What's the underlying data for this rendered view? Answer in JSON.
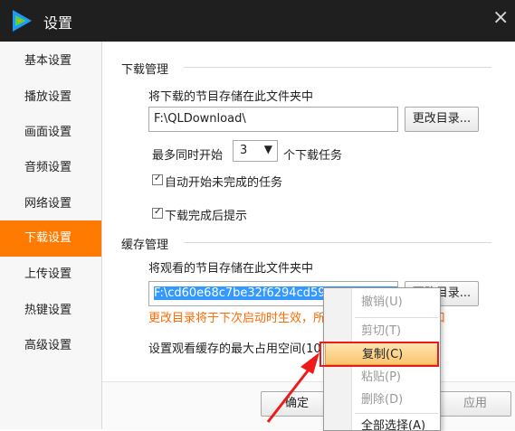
{
  "window": {
    "title": "设置",
    "close_symbol": "×",
    "logo_icon": "tencent-video-logo-icon",
    "brand_colors": [
      "#1a9bfc",
      "#59d241",
      "#ff9a18"
    ]
  },
  "sidebar": {
    "items": [
      {
        "label": "基本设置"
      },
      {
        "label": "播放设置"
      },
      {
        "label": "画面设置"
      },
      {
        "label": "音频设置"
      },
      {
        "label": "网络设置"
      },
      {
        "label": "下载设置"
      },
      {
        "label": "上传设置"
      },
      {
        "label": "热键设置"
      },
      {
        "label": "高级设置"
      }
    ],
    "active_label": "下载设置",
    "active_color": "#ff7a00"
  },
  "download": {
    "section_title": "下载管理",
    "save_label": "将下载的节目存储在此文件夹中",
    "path_value": "F:\\QLDownload\\",
    "change_dir_button": "更改目录...",
    "max_prefix": "最多同时开始",
    "max_value": "3",
    "max_suffix": "个下载任务",
    "auto_start_label": "自动开始未完成的任务",
    "auto_start_checked": true,
    "notify_label": "下载完成后提示",
    "notify_checked": true
  },
  "cache": {
    "section_title": "缓存管理",
    "save_label": "将观看的节目存储在此文件夹中",
    "path_value": "F:\\cd60e68c7be32f6294cd59c2174b2208",
    "change_dir_button": "更改目录...",
    "warning_text": "更改目录将于下次启动时生效，所",
    "warning_suffix": "口",
    "max_space_label": "设置观看缓存的最大占用空间(10",
    "warning_color": "#ff6a00"
  },
  "footer": {
    "confirm_button": "确定",
    "apply_button": "应用"
  },
  "context_menu": {
    "items": [
      {
        "label": "撤销(U)",
        "enabled": false
      },
      {
        "label": "剪切(T)",
        "enabled": false
      },
      {
        "label": "复制(C)",
        "enabled": true,
        "highlight": true
      },
      {
        "label": "粘贴(P)",
        "enabled": false
      },
      {
        "label": "删除(D)",
        "enabled": false
      },
      {
        "label": "全部选择(A)",
        "enabled": true
      }
    ]
  },
  "annotation": {
    "highlight_color": "#ee1a1a",
    "arrow_icon": "red-arrow-icon"
  }
}
